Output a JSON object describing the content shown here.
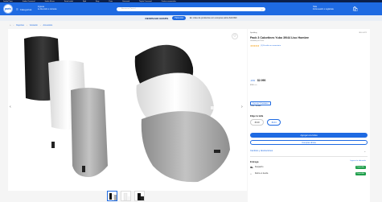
{
  "topbar": {
    "links": [
      "Jumbo Prime",
      "Jumbo Cencosud",
      "Jumbo Masas",
      "Santa Isabel",
      "Spid",
      "Easy",
      "Paris",
      "Cencosud",
      "Tarjeta Cencosud",
      "Centros comerciales"
    ]
  },
  "header": {
    "logo": "paris",
    "categories_label": "Categorías",
    "location_line1": "Ingresa",
    "location_line2": "tu dirección o comuna",
    "search_placeholder": "Buscar en Paris.cl",
    "user_line1": "Hola",
    "user_line2": "Inicia sesión o regístrate"
  },
  "shipbar": {
    "title": "DESPACHO GRATIS",
    "pill": "Paris Azul",
    "message": "En miles de productos con compras sobre $19.990"
  },
  "breadcrumb": [
    "Deportes",
    "Vestuario",
    "Accesorios"
  ],
  "product": {
    "brand": "Spalding",
    "sku": "SKU: 4071",
    "title": "Pack 3 Calcetines Yubo 39/44 Liso Hombre",
    "seller": "Vendido por Paris",
    "rating_stars": "★★★★★",
    "rating_text": "(1) Escribir un comentario",
    "old_price": "-13%",
    "price": "$2.990",
    "unit": "$990 c/u",
    "tag": "Pack de 3 Unidades",
    "sold": "Color: Surtido",
    "size_label": "Elige la talla",
    "sizes": [
      "35-38",
      "39-44"
    ],
    "add_button": "Agregar a la bolsa",
    "buy_button": "Comprar ahora",
    "devol_label": "Cambios y devoluciones",
    "entrega_label": "Entrega",
    "calc_label": "Ingresa tu ubicación",
    "delivery_options": [
      {
        "label": "Despacho",
        "status": "Disponible"
      },
      {
        "label": "Retiro en tienda",
        "status": "Disponible"
      }
    ]
  },
  "colors": {
    "brand_blue": "#1e6ae2",
    "navy": "#0b1f4b",
    "success_green": "#1d9e4a"
  }
}
